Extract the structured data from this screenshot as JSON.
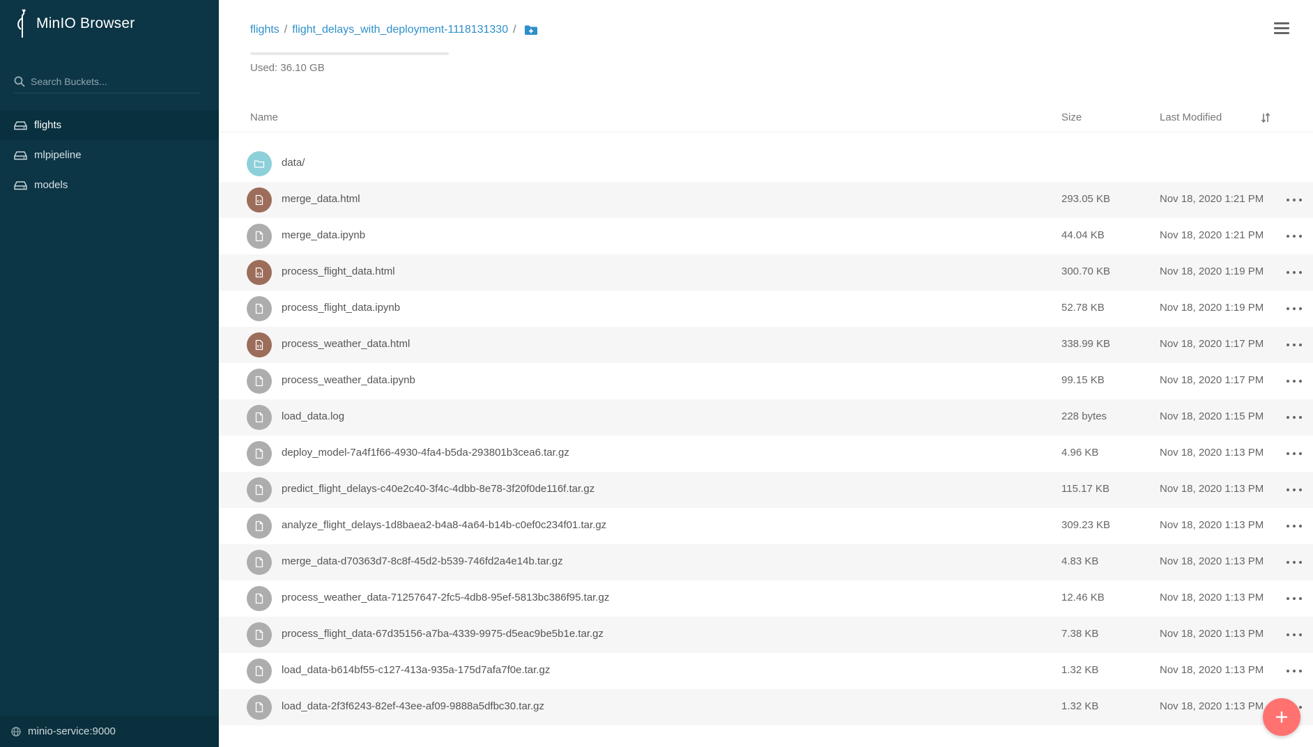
{
  "app": {
    "title": "MinIO Browser"
  },
  "sidebar": {
    "search_placeholder": "Search Buckets...",
    "buckets": [
      {
        "label": "flights",
        "active": true
      },
      {
        "label": "mlpipeline",
        "active": false
      },
      {
        "label": "models",
        "active": false
      }
    ],
    "host": "minio-service:9000"
  },
  "header": {
    "breadcrumb": [
      "flights",
      "flight_delays_with_deployment-1118131330"
    ],
    "usage_text": "Used: 36.10 GB",
    "usage_fraction": 0.0
  },
  "table": {
    "columns": {
      "name": "Name",
      "size": "Size",
      "modified": "Last Modified"
    },
    "rows": [
      {
        "name": "data/",
        "size": "",
        "modified": "",
        "type": "folder"
      },
      {
        "name": "merge_data.html",
        "size": "293.05 KB",
        "modified": "Nov 18, 2020 1:21 PM",
        "type": "html"
      },
      {
        "name": "merge_data.ipynb",
        "size": "44.04 KB",
        "modified": "Nov 18, 2020 1:21 PM",
        "type": "file"
      },
      {
        "name": "process_flight_data.html",
        "size": "300.70 KB",
        "modified": "Nov 18, 2020 1:19 PM",
        "type": "html"
      },
      {
        "name": "process_flight_data.ipynb",
        "size": "52.78 KB",
        "modified": "Nov 18, 2020 1:19 PM",
        "type": "file"
      },
      {
        "name": "process_weather_data.html",
        "size": "338.99 KB",
        "modified": "Nov 18, 2020 1:17 PM",
        "type": "html"
      },
      {
        "name": "process_weather_data.ipynb",
        "size": "99.15 KB",
        "modified": "Nov 18, 2020 1:17 PM",
        "type": "file"
      },
      {
        "name": "load_data.log",
        "size": "228 bytes",
        "modified": "Nov 18, 2020 1:15 PM",
        "type": "file"
      },
      {
        "name": "deploy_model-7a4f1f66-4930-4fa4-b5da-293801b3cea6.tar.gz",
        "size": "4.96 KB",
        "modified": "Nov 18, 2020 1:13 PM",
        "type": "file"
      },
      {
        "name": "predict_flight_delays-c40e2c40-3f4c-4dbb-8e78-3f20f0de116f.tar.gz",
        "size": "115.17 KB",
        "modified": "Nov 18, 2020 1:13 PM",
        "type": "file"
      },
      {
        "name": "analyze_flight_delays-1d8baea2-b4a8-4a64-b14b-c0ef0c234f01.tar.gz",
        "size": "309.23 KB",
        "modified": "Nov 18, 2020 1:13 PM",
        "type": "file"
      },
      {
        "name": "merge_data-d70363d7-8c8f-45d2-b539-746fd2a4e14b.tar.gz",
        "size": "4.83 KB",
        "modified": "Nov 18, 2020 1:13 PM",
        "type": "file"
      },
      {
        "name": "process_weather_data-71257647-2fc5-4db8-95ef-5813bc386f95.tar.gz",
        "size": "12.46 KB",
        "modified": "Nov 18, 2020 1:13 PM",
        "type": "file"
      },
      {
        "name": "process_flight_data-67d35156-a7ba-4339-9975-d5eac9be5b1e.tar.gz",
        "size": "7.38 KB",
        "modified": "Nov 18, 2020 1:13 PM",
        "type": "file"
      },
      {
        "name": "load_data-b614bf55-c127-413a-935a-175d7afa7f0e.tar.gz",
        "size": "1.32 KB",
        "modified": "Nov 18, 2020 1:13 PM",
        "type": "file"
      },
      {
        "name": "load_data-2f3f6243-82ef-43ee-af09-9888a5dfbc30.tar.gz",
        "size": "1.32 KB",
        "modified": "Nov 18, 2020 1:13 PM",
        "type": "file"
      }
    ]
  },
  "colors": {
    "sidebar_bg": "#0c3545",
    "link": "#2e8fc9",
    "folder_icon": "#8ed0da",
    "html_icon": "#9b6d5a",
    "file_icon": "#adadad",
    "fab": "#ff726f"
  },
  "icons": {
    "brand": "minio-bird-logo-icon",
    "search": "search-icon",
    "bucket": "hard-drive-icon",
    "host": "globe-icon",
    "add_folder": "folder-plus-icon",
    "menu": "hamburger-menu-icon",
    "sort": "sort-icon",
    "more": "more-actions-icon",
    "fab": "plus-icon"
  }
}
